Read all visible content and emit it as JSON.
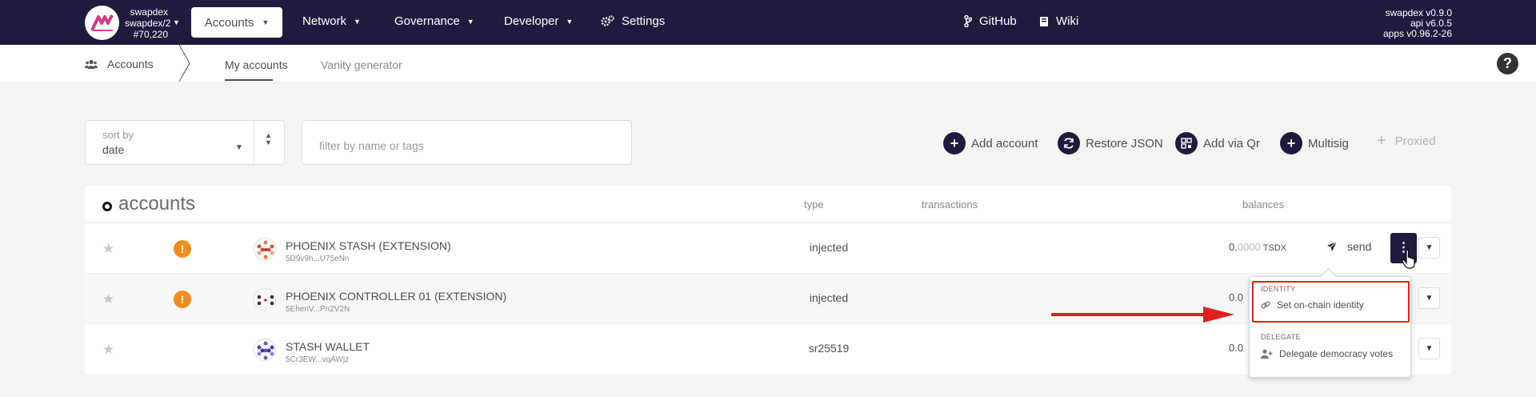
{
  "topbar": {
    "chain_name": "swapdex",
    "chain_network": "swapdex/2",
    "chain_block": "#70,220",
    "nav": [
      {
        "label": "Accounts"
      },
      {
        "label": "Network"
      },
      {
        "label": "Governance"
      },
      {
        "label": "Developer"
      },
      {
        "label": "Settings"
      }
    ],
    "links": [
      {
        "label": "GitHub"
      },
      {
        "label": "Wiki"
      }
    ],
    "versions": [
      "swapdex v0.9.0",
      "api v6.0.5",
      "apps v0.96.2-26"
    ]
  },
  "subheader": {
    "section": "Accounts",
    "tabs": [
      {
        "label": "My accounts",
        "active": true
      },
      {
        "label": "Vanity generator",
        "active": false
      }
    ],
    "help": "?"
  },
  "filters": {
    "sort_label": "sort by",
    "sort_value": "date",
    "filter_placeholder": "filter by name or tags"
  },
  "actions": [
    {
      "label": "Add account",
      "icon": "plus-icon"
    },
    {
      "label": "Restore JSON",
      "icon": "sync-icon"
    },
    {
      "label": "Add via Qr",
      "icon": "qrcode-icon"
    },
    {
      "label": "Multisig",
      "icon": "plus-icon"
    },
    {
      "label": "Proxied",
      "icon": "plus-icon",
      "disabled": true
    }
  ],
  "table": {
    "title": "accounts",
    "columns": {
      "type": "type",
      "transactions": "transactions",
      "balances": "balances"
    },
    "rows": [
      {
        "name": "PHOENIX STASH (EXTENSION)",
        "address": "5D9v9h...U75eNn",
        "type": "injected",
        "balance_int": "0.",
        "balance_frac": "0000",
        "unit": "TSDX",
        "warning": true,
        "send": "send"
      },
      {
        "name": "PHOENIX CONTROLLER 01 (EXTENSION)",
        "address": "5EhenV...Pn2V2N",
        "type": "injected",
        "balance_int": "0.0",
        "warning": true
      },
      {
        "name": "STASH WALLET",
        "address": "5Cr3EW...vqAWjz",
        "type": "sr25519",
        "balance_int": "0.0",
        "warning": false
      }
    ]
  },
  "menu": {
    "identity_header": "IDENTITY",
    "identity_item": "Set on-chain identity",
    "delegate_header": "DELEGATE",
    "delegate_item": "Delegate democracy votes"
  },
  "colors": {
    "topbar": "#211a3f",
    "warning": "#f28c1a",
    "highlight": "#e02020"
  }
}
